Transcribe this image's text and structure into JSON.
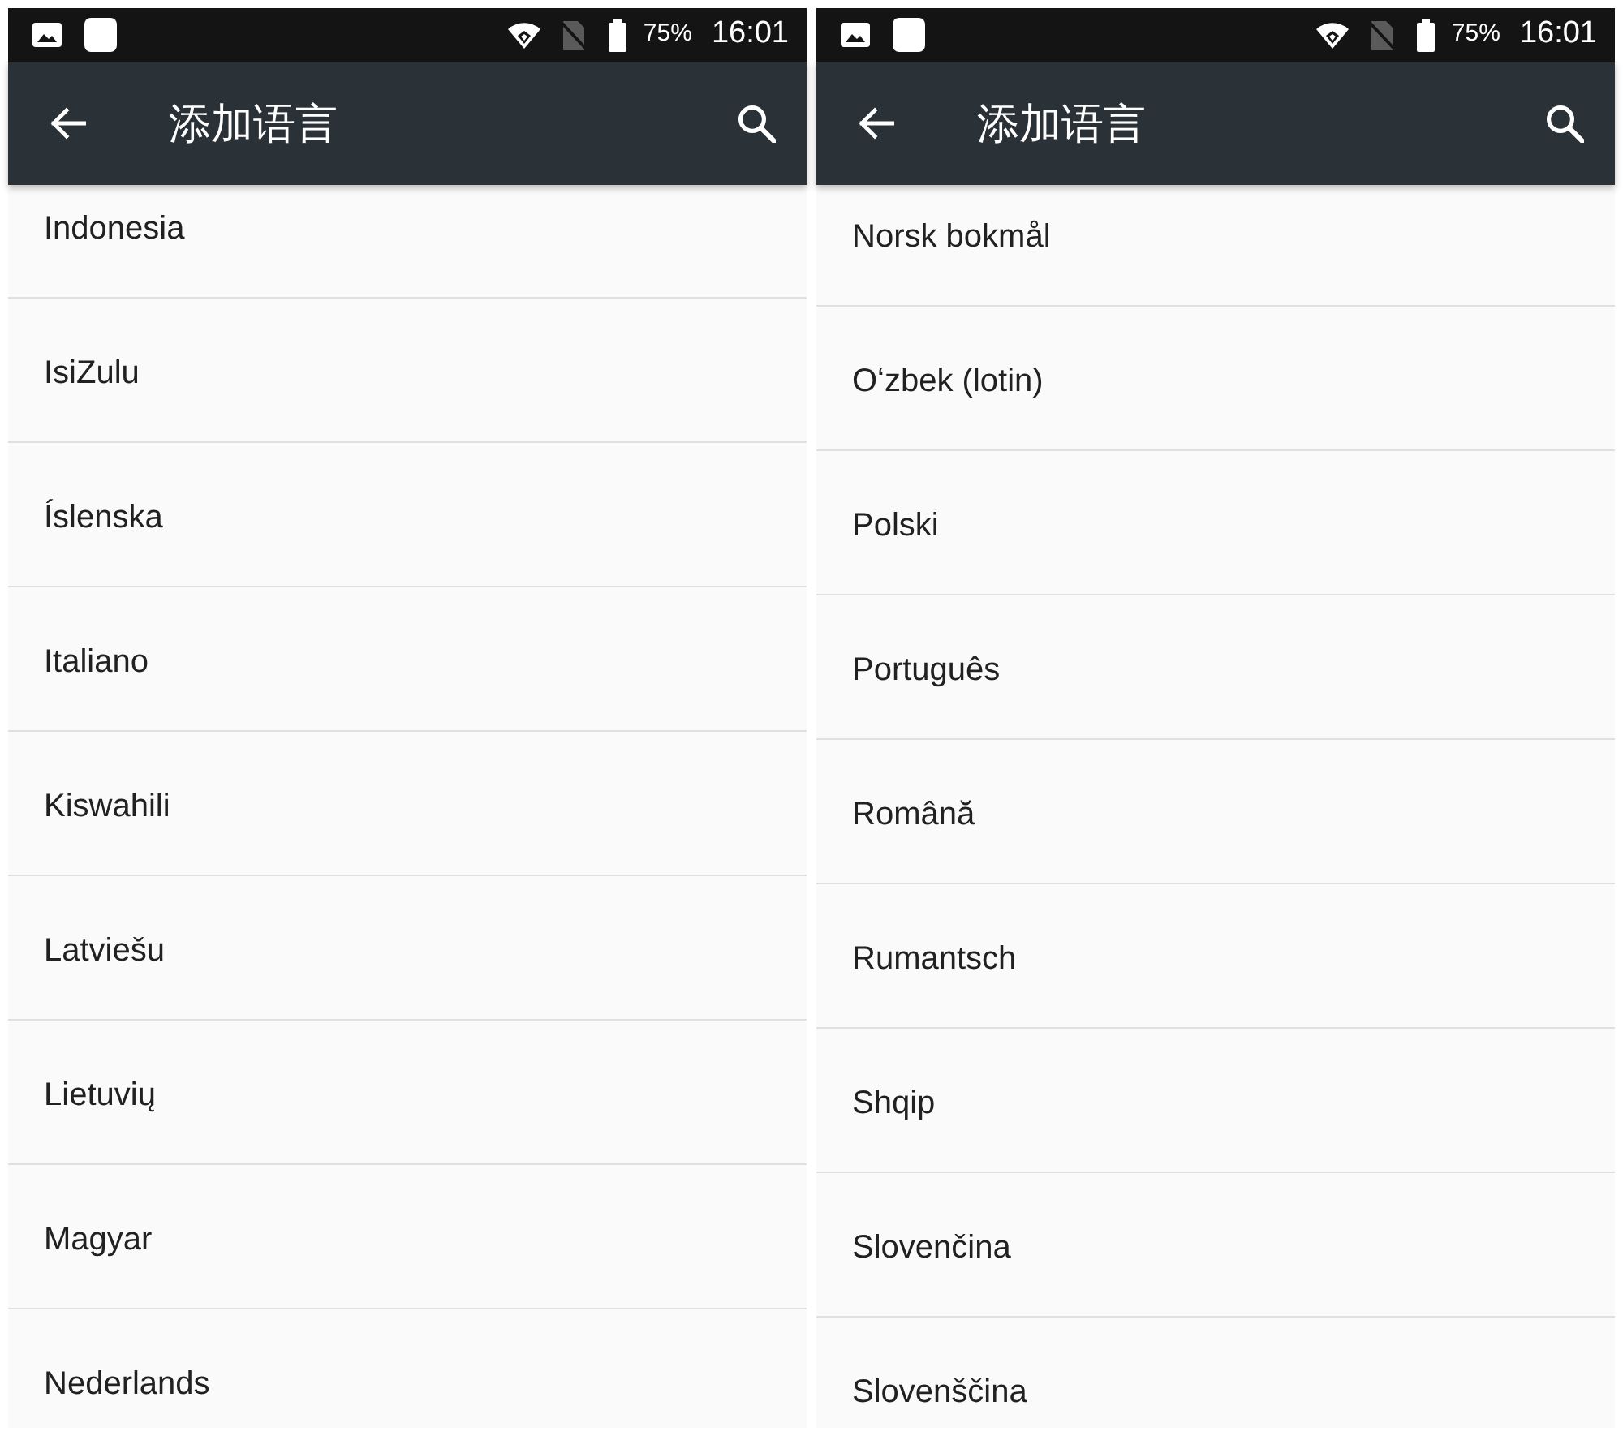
{
  "screens": [
    {
      "status_bar": {
        "battery": "75%",
        "time": "16:01"
      },
      "toolbar": {
        "title": "添加语言"
      },
      "languages": [
        "Indonesia",
        "IsiZulu",
        "Íslenska",
        "Italiano",
        "Kiswahili",
        "Latviešu",
        "Lietuvių",
        "Magyar",
        "Nederlands"
      ]
    },
    {
      "status_bar": {
        "battery": "75%",
        "time": "16:01"
      },
      "toolbar": {
        "title": "添加语言"
      },
      "languages": [
        "Norsk bokmål",
        "Oʻzbek (lotin)",
        "Polski",
        "Português",
        "Română",
        "Rumantsch",
        "Shqip",
        "Slovenčina",
        "Slovenščina"
      ]
    }
  ]
}
